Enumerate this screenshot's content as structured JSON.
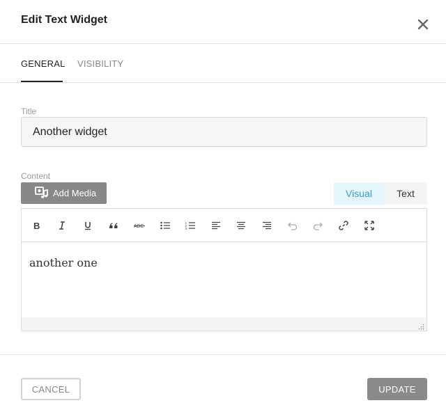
{
  "dialog": {
    "title": "Edit Text Widget"
  },
  "tabs": [
    {
      "label": "GENERAL",
      "active": true
    },
    {
      "label": "VISIBILITY",
      "active": false
    }
  ],
  "fields": {
    "title_label": "Title",
    "title_value": "Another widget",
    "content_label": "Content"
  },
  "editor": {
    "add_media_label": "Add Media",
    "modes": [
      {
        "label": "Visual",
        "active": true
      },
      {
        "label": "Text",
        "active": false
      }
    ],
    "toolbar_icons": [
      "bold-icon",
      "italic-icon",
      "underline-icon",
      "blockquote-icon",
      "strikethrough-icon",
      "bullet-list-icon",
      "numbered-list-icon",
      "align-left-icon",
      "align-center-icon",
      "align-right-icon",
      "undo-icon",
      "redo-icon",
      "link-icon",
      "fullscreen-icon"
    ],
    "content": "another one"
  },
  "footer": {
    "cancel_label": "CANCEL",
    "update_label": "UPDATE"
  },
  "colors": {
    "accent_visual": "#3a9bc8",
    "button_gray": "#888888"
  }
}
